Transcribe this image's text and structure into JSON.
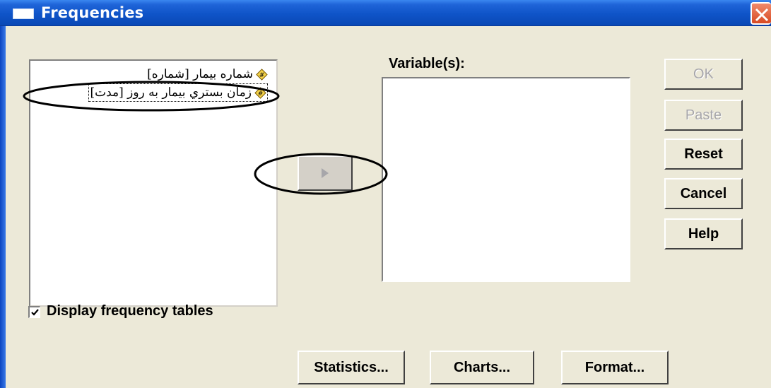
{
  "window": {
    "title": "Frequencies",
    "title_color": "#0a48b5"
  },
  "source_list": {
    "items": [
      {
        "label": "شماره بیمار [شماره]",
        "icon": "scale-variable-icon"
      },
      {
        "label": "زمان بستري بيمار به روز [مدت]",
        "icon": "scale-variable-icon"
      }
    ]
  },
  "target": {
    "label": "Variable(s):"
  },
  "move_button": {
    "icon": "right-arrow-icon"
  },
  "side_buttons": {
    "ok": "OK",
    "paste": "Paste",
    "reset": "Reset",
    "cancel": "Cancel",
    "help": "Help"
  },
  "display_frequency": {
    "label": "Display frequency tables",
    "checked": true
  },
  "bottom_buttons": {
    "statistics": "Statistics...",
    "charts": "Charts...",
    "format": "Format..."
  }
}
